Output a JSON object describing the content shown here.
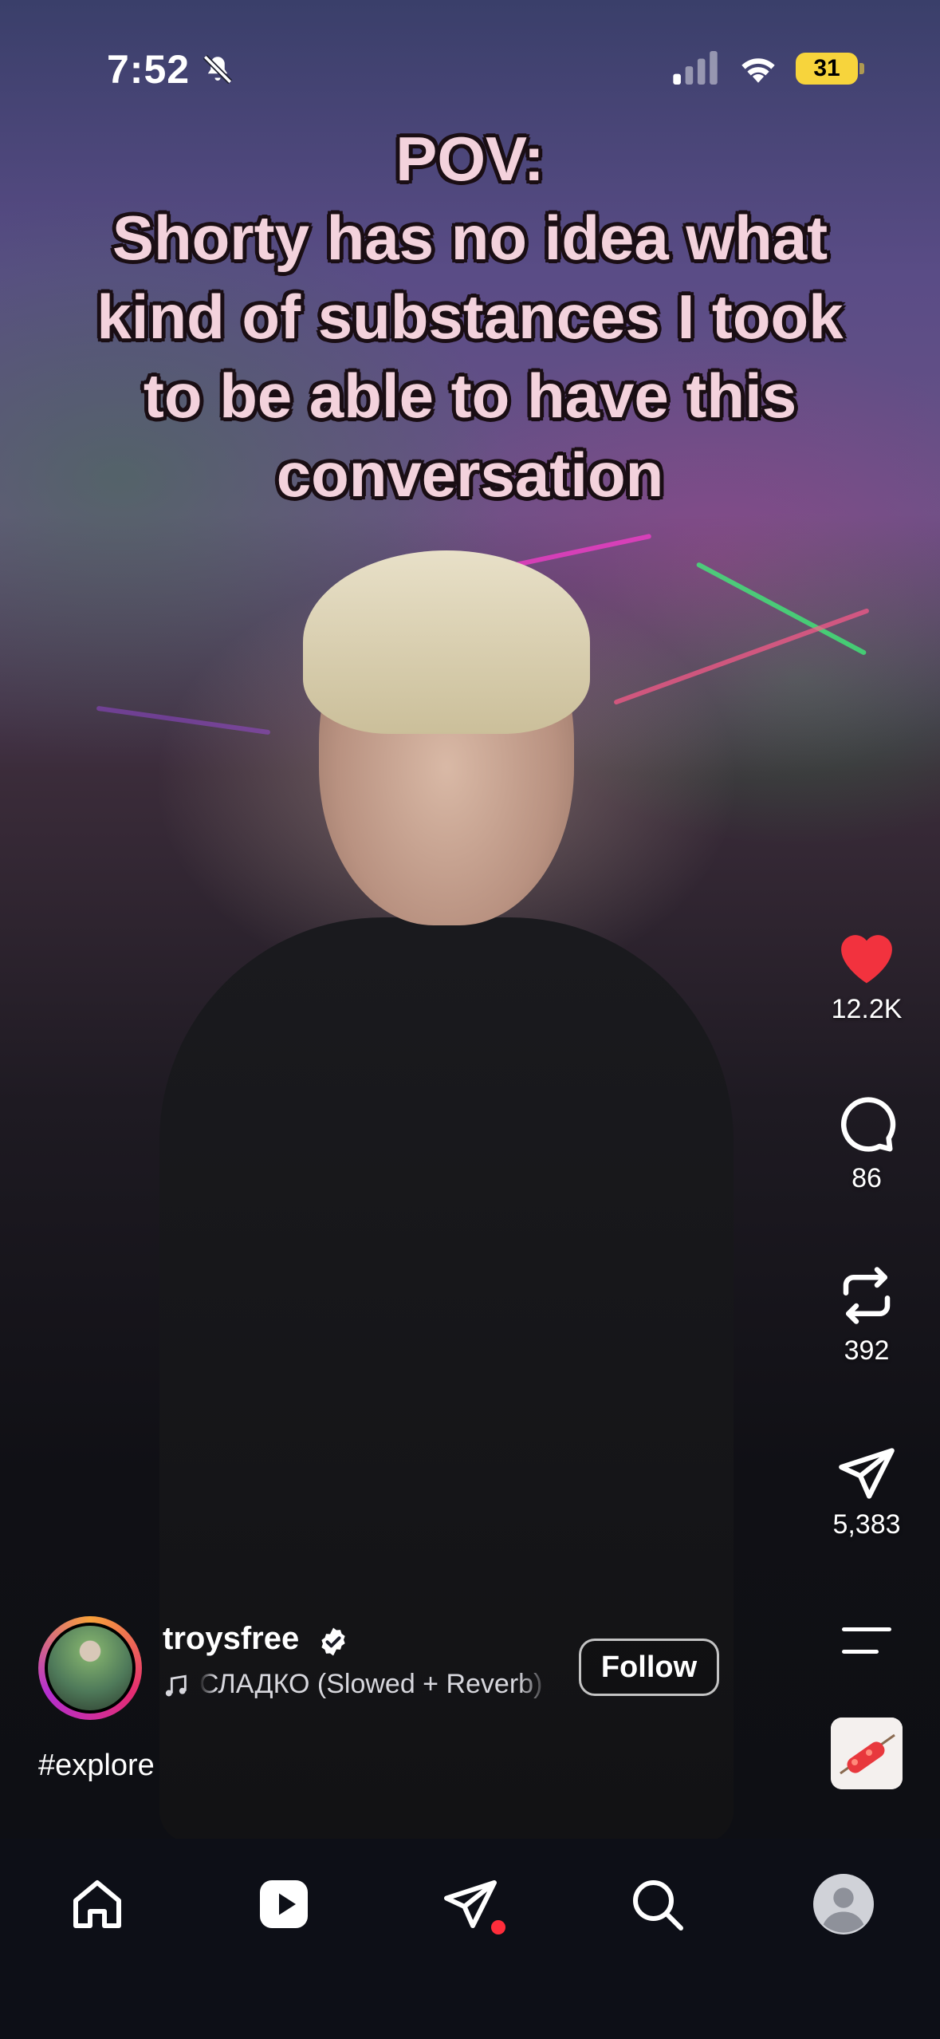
{
  "status_bar": {
    "time": "7:52",
    "battery": "31"
  },
  "caption": {
    "lines": [
      "POV:",
      "Shorty has no idea what",
      "kind of substances I took",
      "to be able to have this",
      "conversation"
    ]
  },
  "actions": {
    "likes": "12.2K",
    "comments": "86",
    "reposts": "392",
    "shares": "5,383"
  },
  "author": {
    "username": "troysfree",
    "song": "СЛАДКО (Slowed + Reverb)",
    "follow_label": "Follow",
    "hashtag": "#explore"
  },
  "colors": {
    "like_red": "#f2323e",
    "battery_yellow": "#f7d43c",
    "tabbar_bg": "#0d0f17",
    "notification_dot": "#ff2d3b"
  },
  "tabs": [
    "home-icon",
    "reels-icon",
    "direct-message-icon",
    "search-icon",
    "profile-icon"
  ]
}
